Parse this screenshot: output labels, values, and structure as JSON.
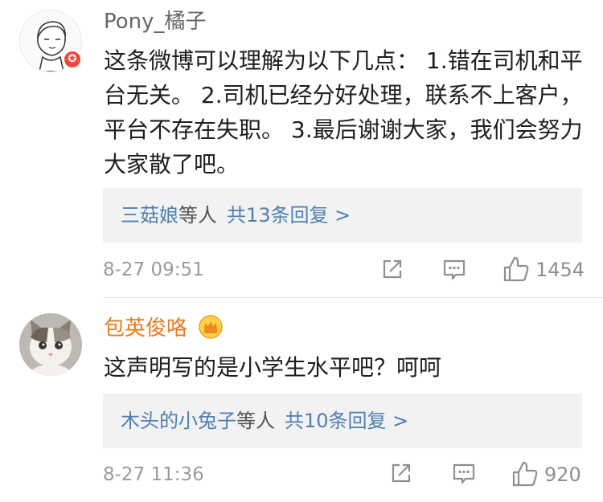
{
  "comments": [
    {
      "user": "Pony_橘子",
      "text": "这条微博可以理解为以下几点： 1.错在司机和平台无关。 2.司机已经分好处理，联系不上客户，平台不存在失职。 3.最后谢谢大家，我们会努力大家散了吧。",
      "replies": {
        "users": "三菇娘",
        "mid": "等人",
        "total": "共13条回复 >"
      },
      "time": "8-27 09:51",
      "likes": "1454",
      "badge_icon": "verified-star-badge"
    },
    {
      "user": "包英俊咯",
      "text": "这声明写的是小学生水平吧？呵呵",
      "replies": {
        "users": "木头的小兔子",
        "mid": "等人",
        "total": "共10条回复 >"
      },
      "time": "8-27 11:36",
      "likes": "920",
      "badge_icon": "crown-icon"
    }
  ],
  "colors": {
    "link": "#4e7fb2",
    "vip_name": "#ea7b1e",
    "badge": "#f2483b"
  }
}
